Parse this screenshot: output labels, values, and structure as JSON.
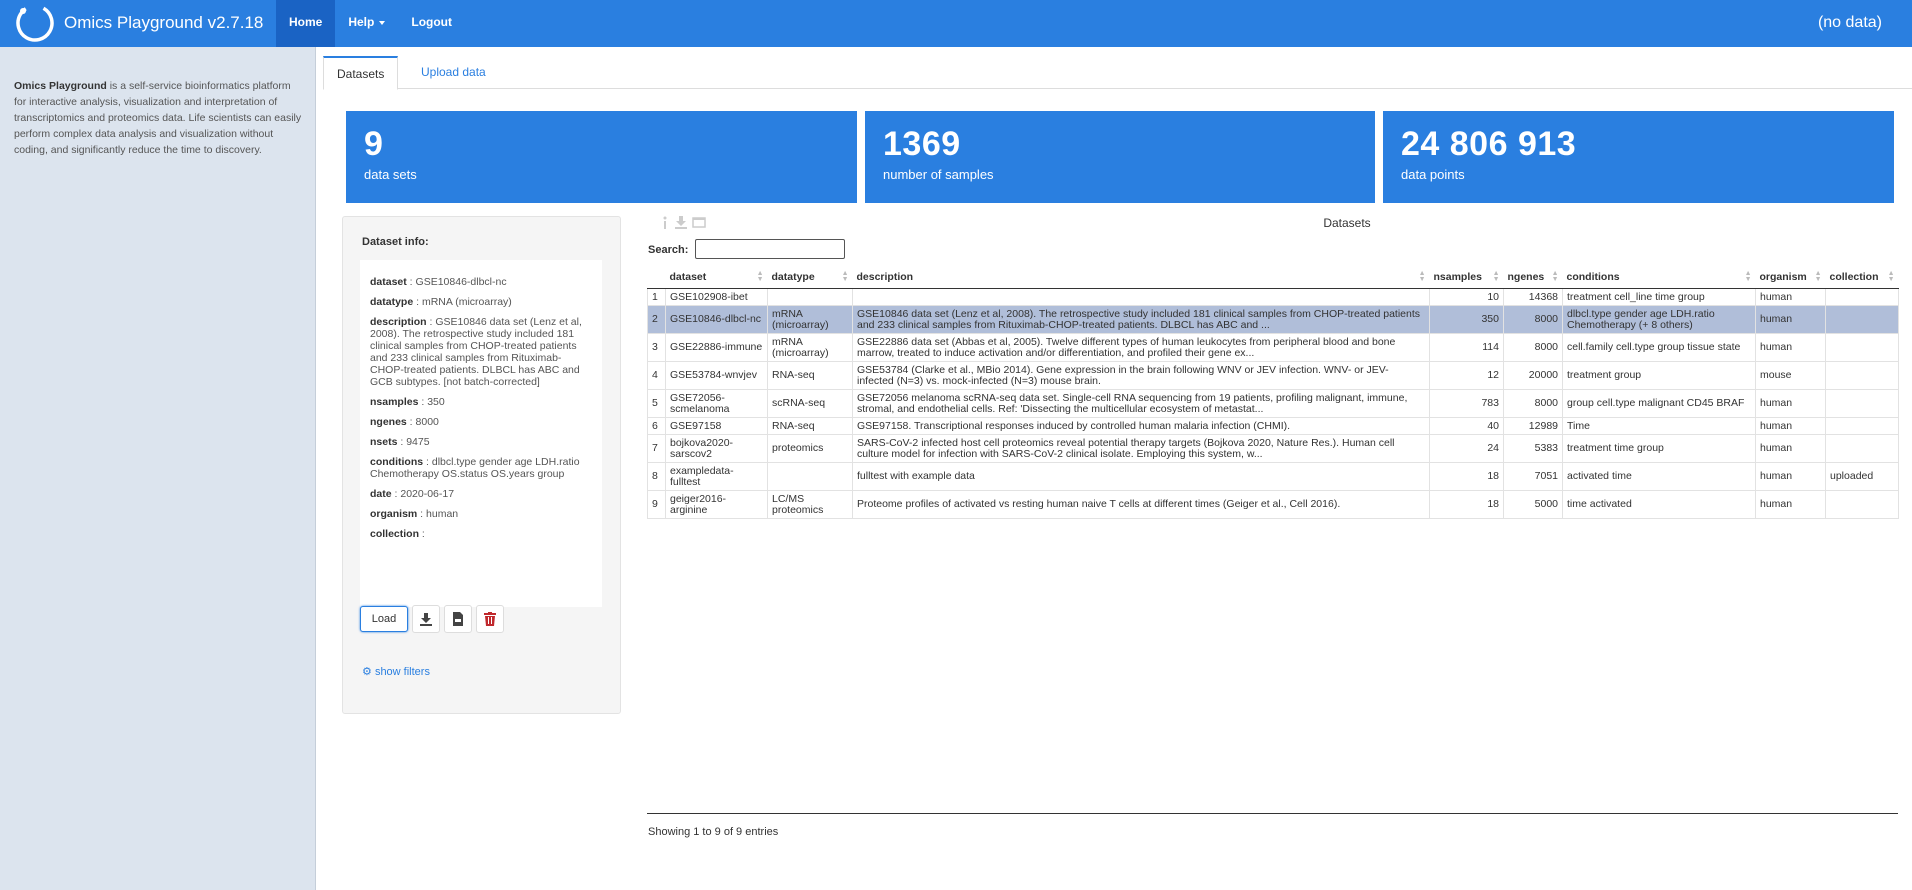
{
  "app": {
    "title": "Omics Playground v2.7.18",
    "status": "(no data)"
  },
  "nav": {
    "home": "Home",
    "help": "Help",
    "logout": "Logout"
  },
  "sidebar": {
    "brand": "Omics Playground",
    "text": " is a self-service bioinformatics platform for interactive analysis, visualization and interpretation of transcriptomics and proteomics data. Life scientists can easily perform complex data analysis and visualization without coding, and significantly reduce the time to discovery."
  },
  "tabs": {
    "datasets": "Datasets",
    "upload": "Upload data"
  },
  "stats": [
    {
      "value": "9",
      "label": "data sets"
    },
    {
      "value": "1369",
      "label": "number of samples"
    },
    {
      "value": "24 806 913",
      "label": "data points"
    }
  ],
  "info": {
    "title": "Dataset info:",
    "rows": [
      {
        "key": "dataset",
        "value": "GSE10846-dlbcl-nc"
      },
      {
        "key": "datatype",
        "value": "mRNA (microarray)"
      },
      {
        "key": "description",
        "value": "GSE10846 data set (Lenz et al, 2008). The retrospective study included 181 clinical samples from CHOP-treated patients and 233 clinical samples from Rituximab-CHOP-treated patients. DLBCL has ABC and GCB subtypes. [not batch-corrected]"
      },
      {
        "key": "nsamples",
        "value": "350"
      },
      {
        "key": "ngenes",
        "value": "8000"
      },
      {
        "key": "nsets",
        "value": "9475"
      },
      {
        "key": "conditions",
        "value": "dlbcl.type gender age LDH.ratio Chemotherapy OS.status OS.years group"
      },
      {
        "key": "date",
        "value": "2020-06-17"
      },
      {
        "key": "organism",
        "value": "human"
      },
      {
        "key": "collection",
        "value": ""
      }
    ],
    "load_label": "Load",
    "show_filters": "show filters"
  },
  "table": {
    "title": "Datasets",
    "search_label": "Search:",
    "columns": [
      "",
      "dataset",
      "datatype",
      "description",
      "nsamples",
      "ngenes",
      "conditions",
      "organism",
      "collection"
    ],
    "rows": [
      [
        "1",
        "GSE102908-ibet",
        "",
        "",
        "10",
        "14368",
        "treatment cell_line time group",
        "human",
        ""
      ],
      [
        "2",
        "GSE10846-dlbcl-nc",
        "mRNA (microarray)",
        "GSE10846 data set (Lenz et al, 2008). The retrospective study included 181 clinical samples from CHOP-treated patients and 233 clinical samples from Rituximab-CHOP-treated patients. DLBCL has ABC and ...",
        "350",
        "8000",
        "dlbcl.type gender age LDH.ratio Chemotherapy (+ 8 others)",
        "human",
        ""
      ],
      [
        "3",
        "GSE22886-immune",
        "mRNA (microarray)",
        "GSE22886 data set (Abbas et al, 2005). Twelve different types of human leukocytes from peripheral blood and bone marrow, treated to induce activation and/or differentiation, and profiled their gene ex...",
        "114",
        "8000",
        "cell.family cell.type group tissue state",
        "human",
        ""
      ],
      [
        "4",
        "GSE53784-wnvjev",
        "RNA-seq",
        "GSE53784 (Clarke et al., MBio 2014). Gene expression in the brain following WNV or JEV infection. WNV- or JEV-infected (N=3) vs. mock-infected (N=3) mouse brain.",
        "12",
        "20000",
        "treatment group",
        "mouse",
        ""
      ],
      [
        "5",
        "GSE72056-scmelanoma",
        "scRNA-seq",
        "GSE72056 melanoma scRNA-seq data set. Single-cell RNA sequencing from 19 patients, profiling malignant, immune, stromal, and endothelial cells. Ref: 'Dissecting the multicellular ecosystem of metastat...",
        "783",
        "8000",
        "group cell.type malignant CD45 BRAF",
        "human",
        ""
      ],
      [
        "6",
        "GSE97158",
        "RNA-seq",
        "GSE97158. Transcriptional responses induced by controlled human malaria infection (CHMI).",
        "40",
        "12989",
        "Time",
        "human",
        ""
      ],
      [
        "7",
        "bojkova2020-sarscov2",
        "proteomics",
        "SARS-CoV-2 infected host cell proteomics reveal potential therapy targets (Bojkova 2020, Nature Res.). Human cell culture model for infection with SARS-CoV-2 clinical isolate. Employing this system, w...",
        "24",
        "5383",
        "treatment time group",
        "human",
        ""
      ],
      [
        "8",
        "exampledata-fulltest",
        "",
        "fulltest with example data",
        "18",
        "7051",
        "activated time",
        "human",
        "uploaded"
      ],
      [
        "9",
        "geiger2016-arginine",
        "LC/MS proteomics",
        "Proteome profiles of activated vs resting human naive T cells at different times (Geiger et al., Cell 2016).",
        "18",
        "5000",
        "time activated",
        "human",
        ""
      ]
    ],
    "selected_row": 2,
    "entries_text": "Showing 1 to 9 of 9 entries"
  }
}
